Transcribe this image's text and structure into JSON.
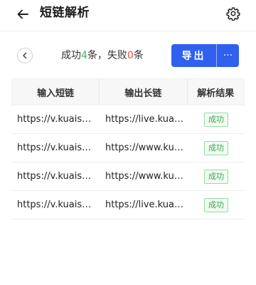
{
  "header": {
    "title": "短链解析"
  },
  "summary": {
    "prefix": "成功",
    "success_count": "4",
    "middle": "条，失败",
    "fail_count": "0",
    "suffix": "条"
  },
  "actions": {
    "export_label": "导出",
    "more_label": "···"
  },
  "table": {
    "headers": [
      "输入短链",
      "输出长链",
      "解析结果"
    ],
    "rows": [
      {
        "input": "https://v.kuaishou.com/",
        "output": "https://live.kuaishou.com/",
        "result": "成功"
      },
      {
        "input": "https://v.kuaishou.com/",
        "output": "https://www.kuaishou.com/",
        "result": "成功"
      },
      {
        "input": "https://v.kuaishou.com/",
        "output": "https://www.kuaishou.com/",
        "result": "成功"
      },
      {
        "input": "https://v.kuaishou.com/",
        "output": "https://live.kuaishou.com/",
        "result": "成功"
      }
    ]
  },
  "colors": {
    "primary": "#2f60ef",
    "success": "#2fb36a",
    "fail": "#f04a3a"
  },
  "icons": {
    "back": "arrow-left-icon",
    "settings": "gear-icon",
    "circle_back": "chevron-left-icon"
  }
}
